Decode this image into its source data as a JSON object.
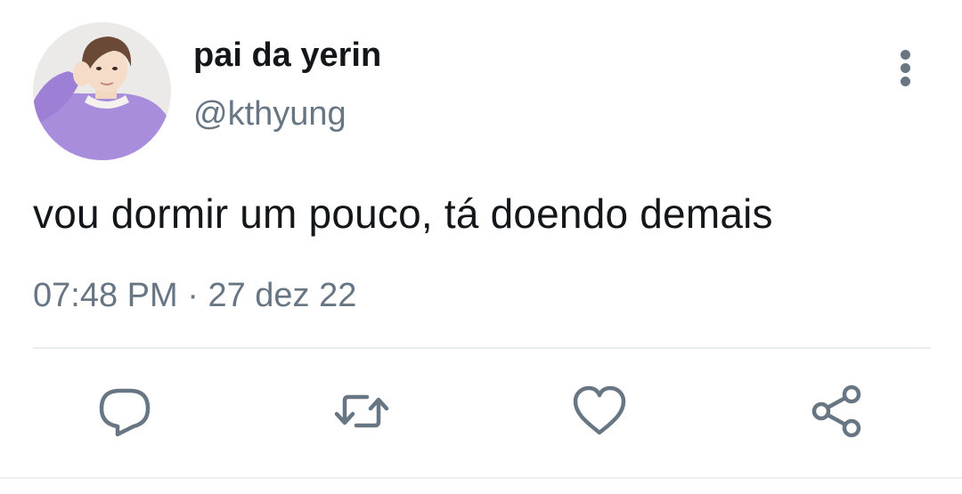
{
  "tweet": {
    "display_name": "pai da yerin",
    "handle": "@kthyung",
    "text": "vou dormir um pouco, tá doendo demais",
    "time": "07:48 PM",
    "separator": "·",
    "date": "27 dez 22"
  },
  "icons": {
    "menu": "more-vertical-icon",
    "reply": "reply-icon",
    "retweet": "retweet-icon",
    "like": "heart-icon",
    "share": "share-icon"
  },
  "colors": {
    "text": "#14171a",
    "secondary": "#687684",
    "divider": "#e6ecf0"
  }
}
